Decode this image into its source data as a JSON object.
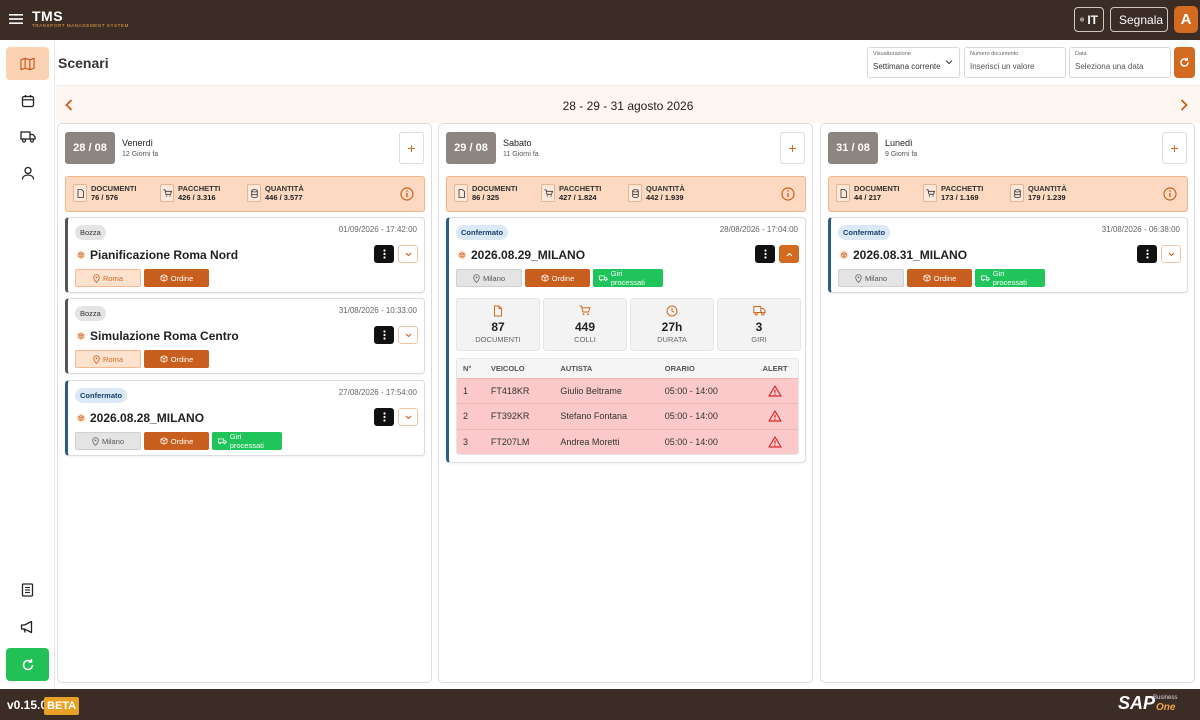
{
  "app": {
    "logo": "TMS",
    "logo_subtitle": "TRANSPORT MANAGEMENT SYSTEM",
    "language": "IT",
    "report_label": "Segnala",
    "avatar_initial": "A",
    "version": "v0.15.0",
    "beta": "BETA",
    "sap_logo": "SAP",
    "sap_business": "Business",
    "sap_one": "One"
  },
  "colors": {
    "topbar": "#3b2d26",
    "accent": "#d26a1f",
    "success": "#1fc45a",
    "alert": "#d62828"
  },
  "sidebar": {
    "items": [
      {
        "icon": "map-icon",
        "active": true
      },
      {
        "icon": "calendar-icon"
      },
      {
        "icon": "truck-icon"
      },
      {
        "icon": "user-icon"
      },
      {
        "icon": "document-list-icon"
      },
      {
        "icon": "megaphone-icon"
      },
      {
        "icon": "refresh-icon"
      }
    ]
  },
  "header": {
    "title": "Scenari",
    "view": {
      "label": "Visualizzazione",
      "value": "Settimana corrente"
    },
    "document": {
      "label": "Numero documento",
      "placeholder": "Inserisci un valore"
    },
    "date": {
      "label": "Data",
      "placeholder": "Seleziona una data"
    }
  },
  "date_range": "28 - 29 - 31 agosto 2026",
  "summary_labels": {
    "documents": "DOCUMENTI",
    "packages": "PACCHETTI",
    "quantity": "QUANTITÀ"
  },
  "chip_labels": {
    "order": "Ordine",
    "routes": "Giri processati"
  },
  "columns": [
    {
      "day": "28 / 08",
      "weekday": "Venerdì",
      "ago": "12 Giorni fa",
      "documents": "76 / 576",
      "packages": "426 / 3.316",
      "quantity": "446 / 3.577",
      "cards": [
        {
          "status": "Bozza",
          "date": "01/09/2026 - 17:42:00",
          "title": "Pianificazione Roma Nord",
          "location": "Roma"
        },
        {
          "status": "Bozza",
          "date": "31/08/2026 - 10:33:00",
          "title": "Simulazione Roma Centro",
          "location": "Roma"
        },
        {
          "status": "Confermato",
          "date": "27/08/2026 - 17:54:00",
          "title": "2026.08.28_MILANO",
          "location": "Milano"
        }
      ]
    },
    {
      "day": "29 / 08",
      "weekday": "Sabato",
      "ago": "11 Giorni fa",
      "documents": "86 / 325",
      "packages": "427 / 1.824",
      "quantity": "442 / 1.939",
      "cards": [
        {
          "status": "Confermato",
          "date": "28/08/2026 - 17:04:00",
          "title": "2026.08.29_MILANO",
          "location": "Milano",
          "stats": [
            {
              "value": "87",
              "label": "DOCUMENTI"
            },
            {
              "value": "449",
              "label": "COLLI"
            },
            {
              "value": "27h",
              "label": "DURATA"
            },
            {
              "value": "3",
              "label": "GIRI"
            }
          ],
          "table": {
            "headers": [
              "N°",
              "VEICOLO",
              "AUTISTA",
              "ORARIO",
              "ALERT"
            ],
            "rows": [
              {
                "n": "1",
                "vehicle": "FT418KR",
                "driver": "Giulio Beltrame",
                "time": "05:00 - 14:00"
              },
              {
                "n": "2",
                "vehicle": "FT392KR",
                "driver": "Stefano Fontana",
                "time": "05:00 - 14:00"
              },
              {
                "n": "3",
                "vehicle": "FT207LM",
                "driver": "Andrea Moretti",
                "time": "05:00 - 14:00"
              }
            ]
          }
        }
      ]
    },
    {
      "day": "31 / 08",
      "weekday": "Lunedì",
      "ago": "9 Giorni fa",
      "documents": "44 / 217",
      "packages": "173 / 1.169",
      "quantity": "179 / 1.239",
      "cards": [
        {
          "status": "Confermato",
          "date": "31/08/2026 - 06:38:00",
          "title": "2026.08.31_MILANO",
          "location": "Milano"
        }
      ]
    }
  ]
}
